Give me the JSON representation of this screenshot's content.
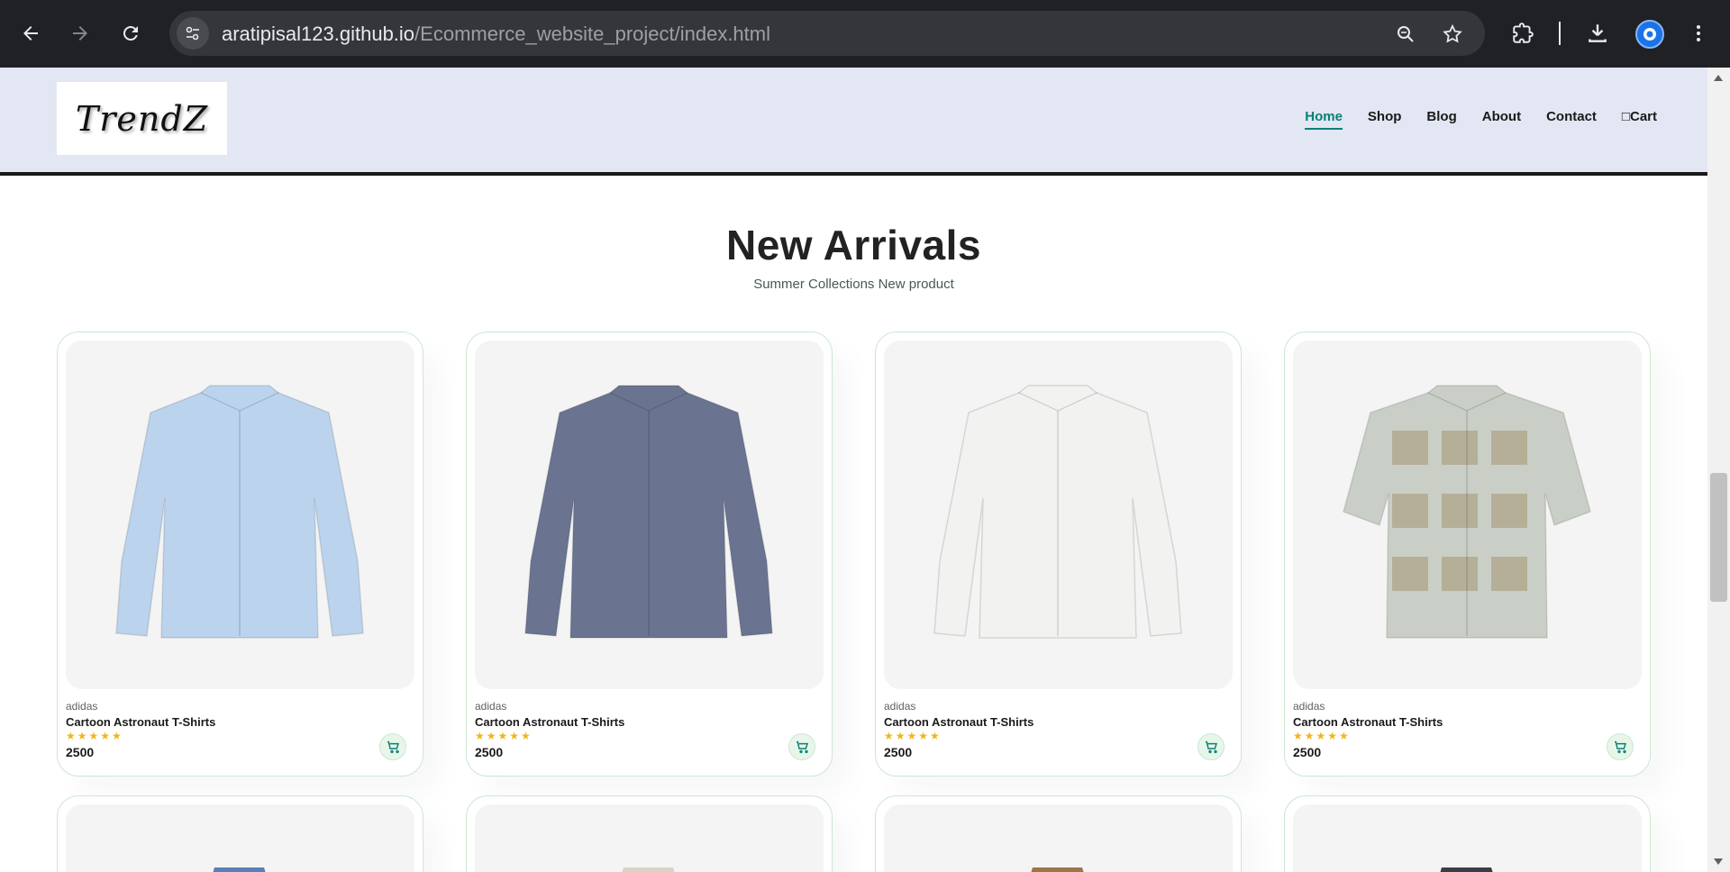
{
  "browser": {
    "url_host": "aratipisal123.github.io",
    "url_path": "/Ecommerce_website_project/index.html"
  },
  "header": {
    "logo_text": "TrendZ",
    "nav": [
      {
        "label": "Home",
        "active": true
      },
      {
        "label": "Shop",
        "active": false
      },
      {
        "label": "Blog",
        "active": false
      },
      {
        "label": "About",
        "active": false
      },
      {
        "label": "Contact",
        "active": false
      },
      {
        "label": "□Cart",
        "active": false
      }
    ]
  },
  "section": {
    "title": "New Arrivals",
    "subtitle": "Summer Collections New product"
  },
  "products": [
    {
      "brand": "adidas",
      "name": "Cartoon Astronaut T-Shirts",
      "stars": "★★★★★",
      "price": "2500",
      "shirt_color": "#bcd3ee",
      "image": "light-blue-shirt"
    },
    {
      "brand": "adidas",
      "name": "Cartoon Astronaut T-Shirts",
      "stars": "★★★★★",
      "price": "2500",
      "shirt_color": "#6a7491",
      "image": "navy-check-shirt"
    },
    {
      "brand": "adidas",
      "name": "Cartoon Astronaut T-Shirts",
      "stars": "★★★★★",
      "price": "2500",
      "shirt_color": "#f2f2f0",
      "image": "white-shirt"
    },
    {
      "brand": "adidas",
      "name": "Cartoon Astronaut T-Shirts",
      "stars": "★★★★★",
      "price": "2500",
      "shirt_color": "#c9cfc6",
      "image": "printed-short-sleeve-shirt"
    }
  ],
  "colors": {
    "accent": "#088178",
    "header_bg": "#e3e6f3",
    "card_border": "#cce7d0",
    "star": "#f3b519"
  }
}
